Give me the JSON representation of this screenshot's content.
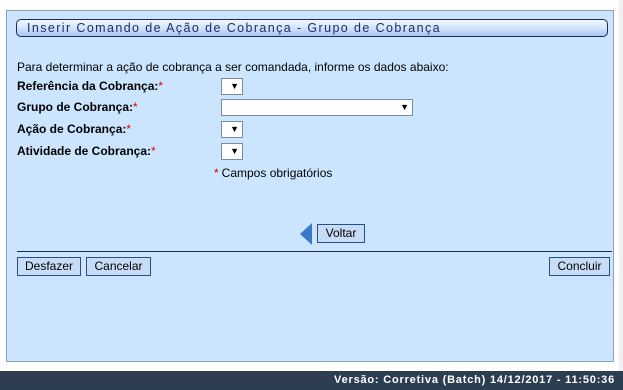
{
  "page_title": "Inserir Comando de Ação de Cobrança - Grupo de Cobrança",
  "intro_text": "Para determinar a ação de cobrança a ser comandada, informe os dados abaixo:",
  "required_marker": "*",
  "fields": [
    {
      "label": "Referência da Cobrança:",
      "selected": ""
    },
    {
      "label": "Grupo de Cobrança:",
      "selected": ""
    },
    {
      "label": "Ação de Cobrança:",
      "selected": ""
    },
    {
      "label": "Atividade de Cobrança:",
      "selected": ""
    }
  ],
  "required_note": "Campos obrigatórios",
  "buttons": {
    "voltar": "Voltar",
    "desfazer": "Desfazer",
    "cancelar": "Cancelar",
    "concluir": "Concluir"
  },
  "status_bar": "Versão: Corretiva (Batch) 14/12/2017 - 11:50:36",
  "colors": {
    "panel_bg": "#cbe5fe",
    "title_text": "#1d2d68",
    "required": "#e00000",
    "status_bar_bg": "#2c3e50"
  }
}
